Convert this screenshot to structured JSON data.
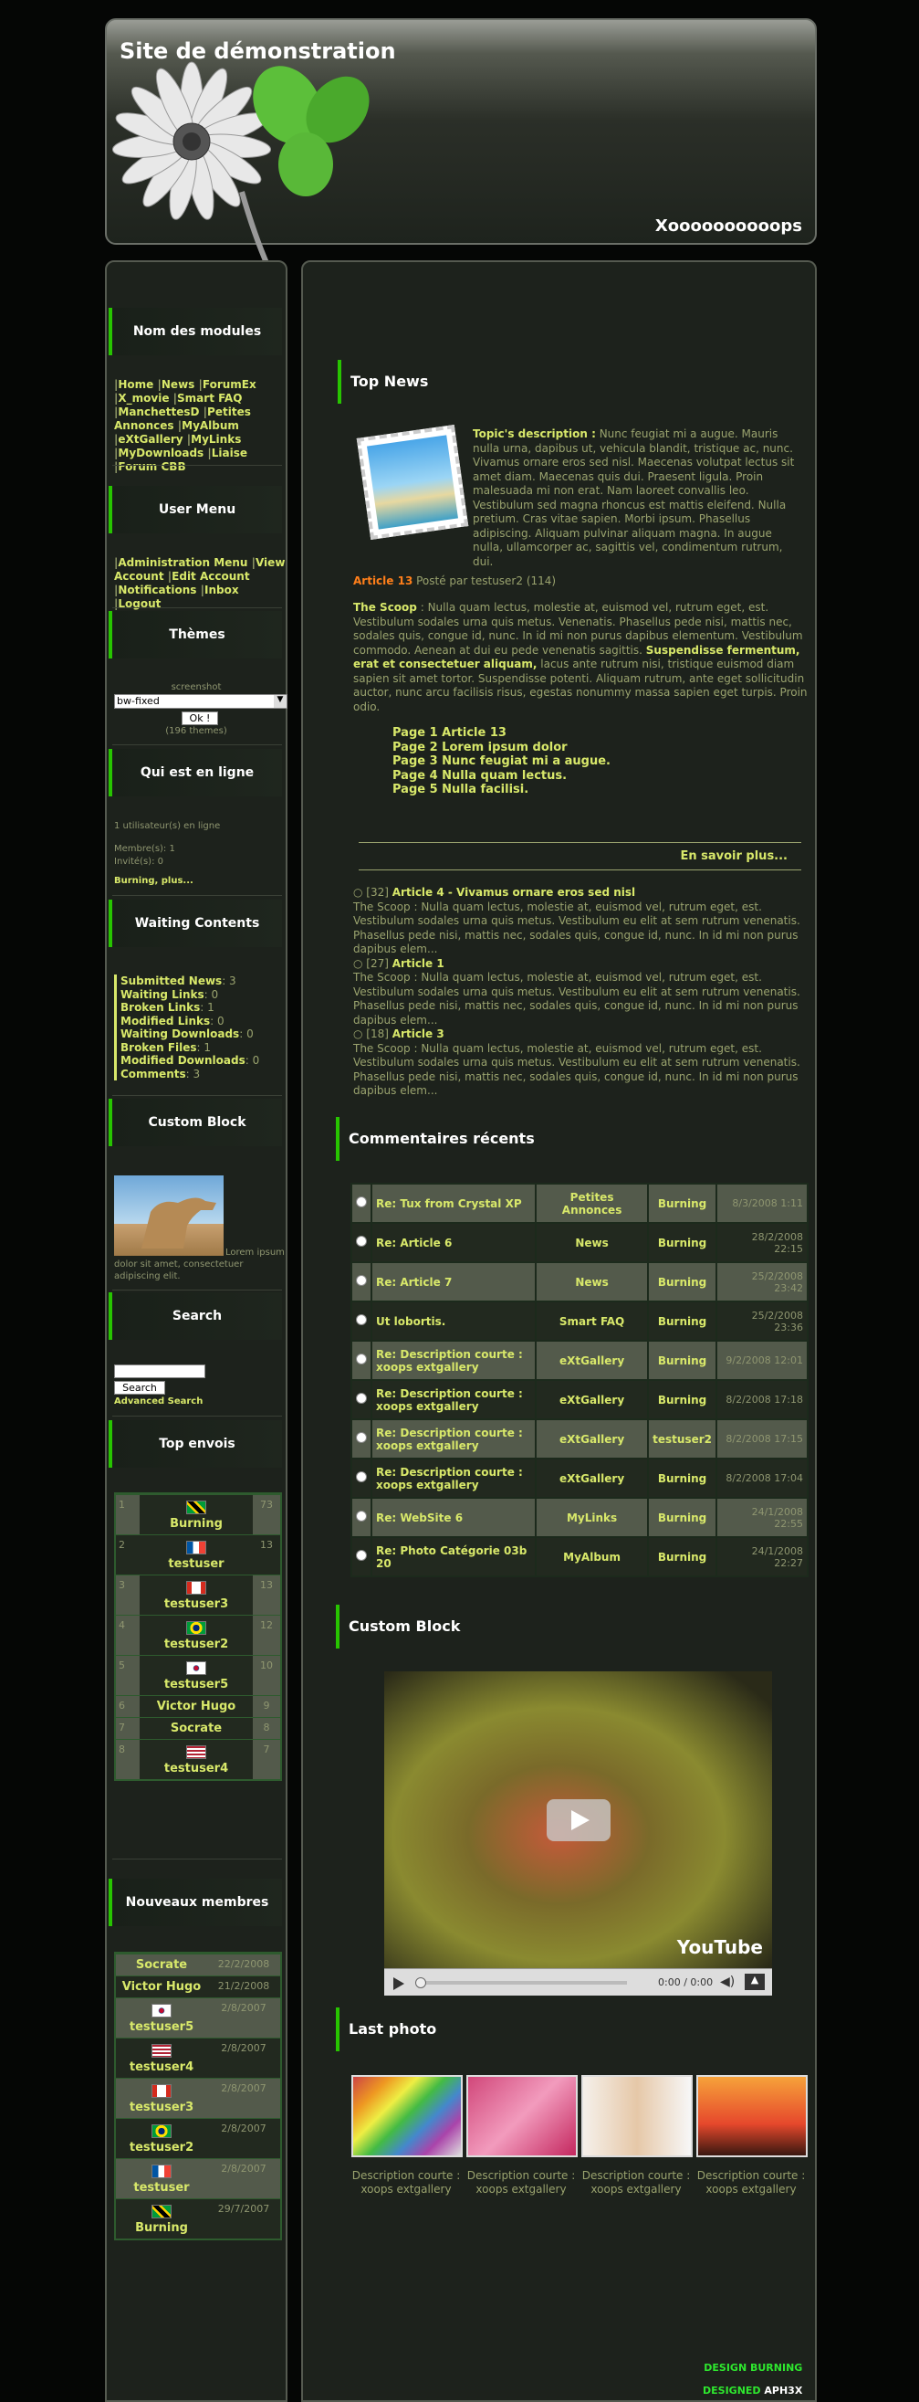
{
  "site": {
    "title": "Site de démonstration",
    "slogan": "Xoooooooooops"
  },
  "left": {
    "modules_title": "Nom des modules",
    "modules": [
      "Home",
      "News",
      "ForumEx",
      "X_movie",
      "Smart FAQ",
      "ManchettesD",
      "Petites Annonces",
      "MyAlbum",
      "eXtGallery",
      "MyLinks",
      "MyDownloads",
      "Liaise",
      "Forum CBB"
    ],
    "usermenu_title": "User Menu",
    "usermenu": [
      "Administration Menu",
      "View Account",
      "Edit Account",
      "Notifications",
      "Inbox",
      "Logout"
    ],
    "themes_title": "Thèmes",
    "themes_screenshot": "screenshot",
    "themes_select": "bw-fixed",
    "themes_ok": "Ok !",
    "themes_count": "(196 themes)",
    "online_title": "Qui est en ligne",
    "online_users": "1 utilisateur(s) en ligne",
    "online_members": "Membre(s): 1",
    "online_guests": "Invité(s): 0",
    "online_list": "Burning, plus...",
    "waiting_title": "Waiting Contents",
    "waiting": [
      {
        "label": "Submitted News",
        "count": "3"
      },
      {
        "label": "Waiting Links",
        "count": "0"
      },
      {
        "label": "Broken Links",
        "count": "1"
      },
      {
        "label": "Modified Links",
        "count": "0"
      },
      {
        "label": "Waiting Downloads",
        "count": "0"
      },
      {
        "label": "Broken Files",
        "count": "1"
      },
      {
        "label": "Modified Downloads",
        "count": "0"
      },
      {
        "label": "Comments",
        "count": "3"
      }
    ],
    "custom_title": "Custom Block",
    "custom_text": "Lorem ipsum dolor sit amet, consectetuer adipiscing elit.",
    "search_title": "Search",
    "search_button": "Search",
    "search_advanced": "Advanced Search",
    "top_title": "Top envois",
    "top": [
      {
        "n": "1",
        "name": "Burning",
        "c": "73",
        "flag": "jm"
      },
      {
        "n": "2",
        "name": "testuser",
        "c": "13",
        "flag": "fr"
      },
      {
        "n": "3",
        "name": "testuser3",
        "c": "13",
        "flag": "ca"
      },
      {
        "n": "4",
        "name": "testuser2",
        "c": "12",
        "flag": "br"
      },
      {
        "n": "5",
        "name": "testuser5",
        "c": "10",
        "flag": "kr"
      },
      {
        "n": "6",
        "name": "Victor Hugo",
        "c": "9",
        "flag": ""
      },
      {
        "n": "7",
        "name": "Socrate",
        "c": "8",
        "flag": ""
      },
      {
        "n": "8",
        "name": "testuser4",
        "c": "7",
        "flag": "us"
      }
    ],
    "new_title": "Nouveaux membres",
    "newmembers": [
      {
        "name": "Socrate",
        "date": "22/2/2008",
        "flag": ""
      },
      {
        "name": "Victor Hugo",
        "date": "21/2/2008",
        "flag": ""
      },
      {
        "name": "testuser5",
        "date": "2/8/2007",
        "flag": "kr"
      },
      {
        "name": "testuser4",
        "date": "2/8/2007",
        "flag": "us"
      },
      {
        "name": "testuser3",
        "date": "2/8/2007",
        "flag": "ca"
      },
      {
        "name": "testuser2",
        "date": "2/8/2007",
        "flag": "br"
      },
      {
        "name": "testuser",
        "date": "2/8/2007",
        "flag": "fr"
      },
      {
        "name": "Burning",
        "date": "29/7/2007",
        "flag": "jm"
      }
    ]
  },
  "main": {
    "topnews_title": "Top News",
    "topic_label": "Topic's description :",
    "topic_text": "Nunc feugiat mi a augue. Mauris nulla urna, dapibus ut, vehicula blandit, tristique ac, nunc. Vivamus ornare eros sed nisl. Maecenas volutpat lectus sit amet diam. Maecenas quis dui. Praesent ligula. Proin malesuada mi non erat. Nam laoreet convallis leo. Vestibulum sed magna rhoncus est mattis eleifend. Nulla pretium. Cras vitae sapien. Morbi ipsum. Phasellus adipiscing. Aliquam pulvinar aliquam magna. In augue nulla, ullamcorper ac, sagittis vel, condimentum rutrum, dui.",
    "article_link": "Article 13",
    "article_meta": "Posté par testuser2 (114)",
    "scoop_label": "The Scoop",
    "scoop_text": ": Nulla quam lectus, molestie at, euismod vel, rutrum eget, est. Vestibulum sodales urna quis metus. Venenatis. Phasellus pede nisi, mattis nec, sodales quis, congue id, nunc. In id mi non purus dapibus elementum. Vestibulum commodo. Aenean at dui eu pede venenatis sagittis.",
    "scoop_bold": "Suspendisse fermentum, erat et consectetuer aliquam,",
    "scoop_text2": "lacus ante rutrum nisi, tristique euismod diam sapien sit amet tortor. Suspendisse potenti. Aliquam rutrum, ante eget sollicitudin auctor, nunc arcu facilisis risus, egestas nonummy massa sapien eget turpis. Proin odio.",
    "pages": [
      "Page 1 Article 13",
      "Page 2 Lorem ipsum dolor",
      "Page 3 Nunc feugiat mi a augue.",
      "Page 4 Nulla quam lectus.",
      "Page 5 Nulla facilisi."
    ],
    "more": "En savoir plus...",
    "list": [
      {
        "count": "[32]",
        "title": "Article 4 - Vivamus ornare eros sed nisl",
        "text": "The Scoop : Nulla quam lectus, molestie at, euismod vel, rutrum eget, est. Vestibulum sodales urna quis metus. Vestibulum eu elit at sem rutrum venenatis. Phasellus pede nisi, mattis nec, sodales quis, congue id, nunc. In id mi non purus dapibus elem..."
      },
      {
        "count": "[27]",
        "title": "Article 1",
        "text": "The Scoop : Nulla quam lectus, molestie at, euismod vel, rutrum eget, est. Vestibulum sodales urna quis metus. Vestibulum eu elit at sem rutrum venenatis. Phasellus pede nisi, mattis nec, sodales quis, congue id, nunc. In id mi non purus dapibus elem..."
      },
      {
        "count": "[18]",
        "title": "Article 3",
        "text": "The Scoop : Nulla quam lectus, molestie at, euismod vel, rutrum eget, est. Vestibulum sodales urna quis metus. Vestibulum eu elit at sem rutrum venenatis. Phasellus pede nisi, mattis nec, sodales quis, congue id, nunc. In id mi non purus dapibus elem..."
      }
    ],
    "comments_title": "Commentaires récents",
    "comments": [
      {
        "t": "Re: Tux from Crystal XP",
        "m": "Petites Annonces",
        "u": "Burning",
        "d": "8/3/2008 1:11"
      },
      {
        "t": "Re: Article 6",
        "m": "News",
        "u": "Burning",
        "d": "28/2/2008 22:15"
      },
      {
        "t": "Re: Article 7",
        "m": "News",
        "u": "Burning",
        "d": "25/2/2008 23:42"
      },
      {
        "t": "Ut lobortis.",
        "m": "Smart FAQ",
        "u": "Burning",
        "d": "25/2/2008 23:36"
      },
      {
        "t": "Re: Description courte : xoops extgallery",
        "m": "eXtGallery",
        "u": "Burning",
        "d": "9/2/2008 12:01"
      },
      {
        "t": "Re: Description courte : xoops extgallery",
        "m": "eXtGallery",
        "u": "Burning",
        "d": "8/2/2008 17:18"
      },
      {
        "t": "Re: Description courte : xoops extgallery",
        "m": "eXtGallery",
        "u": "testuser2",
        "d": "8/2/2008 17:15"
      },
      {
        "t": "Re: Description courte : xoops extgallery",
        "m": "eXtGallery",
        "u": "Burning",
        "d": "8/2/2008 17:04"
      },
      {
        "t": "Re: WebSite 6",
        "m": "MyLinks",
        "u": "Burning",
        "d": "24/1/2008 22:55"
      },
      {
        "t": "Re: Photo Catégorie 03b 20",
        "m": "MyAlbum",
        "u": "Burning",
        "d": "24/1/2008 22:27"
      }
    ],
    "custom_title": "Custom Block",
    "video_time": "0:00 / 0:00",
    "video_brand": "YouTube",
    "photo_title": "Last photo",
    "photos": [
      "Description courte : xoops extgallery",
      "Description courte : xoops extgallery",
      "Description courte : xoops extgallery",
      "Description courte : xoops extgallery"
    ],
    "footer1": "DESIGN BURNING",
    "footer2": "DESIGNED",
    "footer3": "APH3X"
  }
}
